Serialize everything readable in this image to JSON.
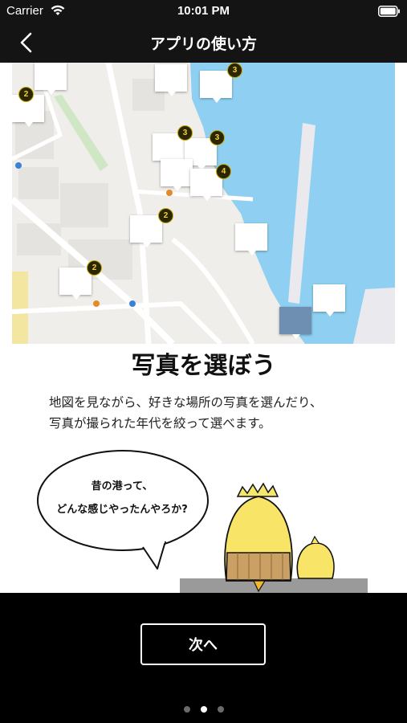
{
  "status_bar": {
    "carrier": "Carrier",
    "time": "10:01 PM",
    "wifi_icon": "wifi-icon",
    "battery_icon": "battery-icon"
  },
  "nav": {
    "back_icon": "chevron-left-icon",
    "title": "アプリの使い方"
  },
  "map": {
    "pin_counts": [
      "2",
      "3",
      "3",
      "3",
      "4",
      "2",
      "2"
    ],
    "water_color": "#8fd0f2",
    "land_color": "#f0eeea",
    "badge_color": "#f2d23a"
  },
  "main": {
    "heading": "写真を選ぼう",
    "description_lines": [
      "地図を見ながら、好きな場所の写真を選んだり、",
      "写真が撮られた年代を絞って選べます。"
    ]
  },
  "speech_bubble": {
    "lines": [
      "昔の港って、",
      "どんな感じやったんやろか?"
    ]
  },
  "footer": {
    "next_label": "次へ",
    "page_count": 3,
    "current_page": 2
  }
}
